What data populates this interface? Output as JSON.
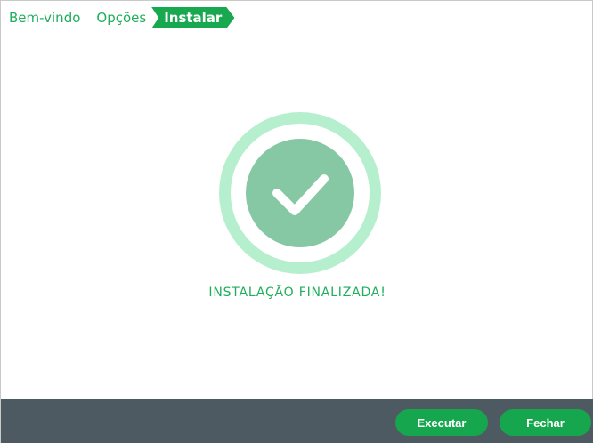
{
  "steps": {
    "items": [
      {
        "label": "Bem-vindo"
      },
      {
        "label": "Opções"
      },
      {
        "label": "Instalar"
      }
    ],
    "active_index": 2
  },
  "status": {
    "message": "INSTALAÇÃO FINALIZADA!",
    "icon": "check-icon"
  },
  "footer": {
    "run_label": "Executar",
    "close_label": "Fechar"
  },
  "colors": {
    "accent": "#18a850",
    "text_green": "#1fae5c",
    "ring_light": "#b6efcd",
    "disc": "#86c8a3",
    "footer_bg": "#4e5a61"
  }
}
